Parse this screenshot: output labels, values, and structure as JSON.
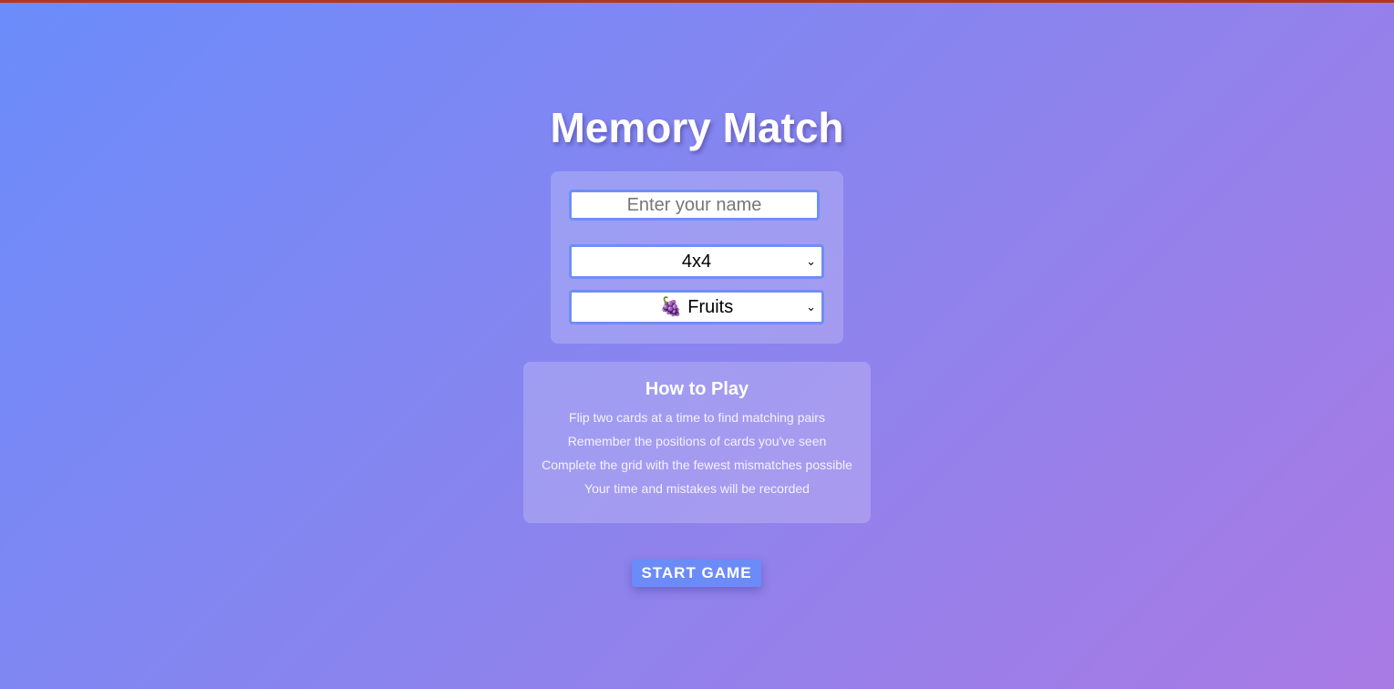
{
  "title": "Memory Match",
  "settings": {
    "name_placeholder": "Enter your name",
    "grid_size": "4x4",
    "theme": "🍇 Fruits"
  },
  "how_to": {
    "title": "How to Play",
    "lines": [
      "Flip two cards at a time to find matching pairs",
      "Remember the positions of cards you've seen",
      "Complete the grid with the fewest mismatches possible",
      "Your time and mistakes will be recorded"
    ]
  },
  "start_label": "START GAME",
  "colors": {
    "accent": "#6b8bf8",
    "top_strip": "#b3361f"
  }
}
